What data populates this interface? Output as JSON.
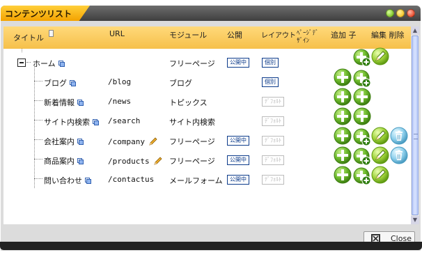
{
  "window": {
    "title": "コンテンツリスト"
  },
  "header": {
    "title": "タイトル",
    "url": "URL",
    "module": "モジュール",
    "public": "公開",
    "layout": "レイアウト",
    "page_design_1": "ﾍﾟｰｼﾞﾃﾞ",
    "page_design_2": "ｻﾞｲﾝ",
    "add_child": "追加 子",
    "edit_delete": "編集 削除"
  },
  "rows": [
    {
      "title": "ホーム",
      "url": "",
      "module": "フリーページ",
      "public": "公開中",
      "layout": "個別"
    },
    {
      "title": "ブログ",
      "url": "/blog",
      "module": "ブログ",
      "public": "",
      "layout": "個別"
    },
    {
      "title": "新着情報",
      "url": "/news",
      "module": "トピックス",
      "public": "",
      "layout": "ﾃﾞﾌｫﾙﾄ"
    },
    {
      "title": "サイト内検索",
      "url": "/search",
      "module": "サイト内検索",
      "public": "",
      "layout": "ﾃﾞﾌｫﾙﾄ"
    },
    {
      "title": "会社案内",
      "url": "/company",
      "module": "フリーページ",
      "public": "公開中",
      "layout": "ﾃﾞﾌｫﾙﾄ"
    },
    {
      "title": "商品案内",
      "url": "/products",
      "module": "フリーページ",
      "public": "公開中",
      "layout": "ﾃﾞﾌｫﾙﾄ"
    },
    {
      "title": "問い合わせ",
      "url": "/contactus",
      "module": "メールフォーム",
      "public": "公開中",
      "layout": "ﾃﾞﾌｫﾙﾄ"
    }
  ],
  "footer": {
    "close_label": "Close"
  },
  "colors": {
    "accent": "#f6c04a",
    "green": "#6bb82a",
    "blue": "#0b3a8a"
  },
  "icons": {
    "copy": "copy-icon",
    "pencil": "pencil-icon",
    "add": "add-icon",
    "add_child": "add-child-icon",
    "edit": "edit-icon",
    "delete": "trash-icon"
  }
}
